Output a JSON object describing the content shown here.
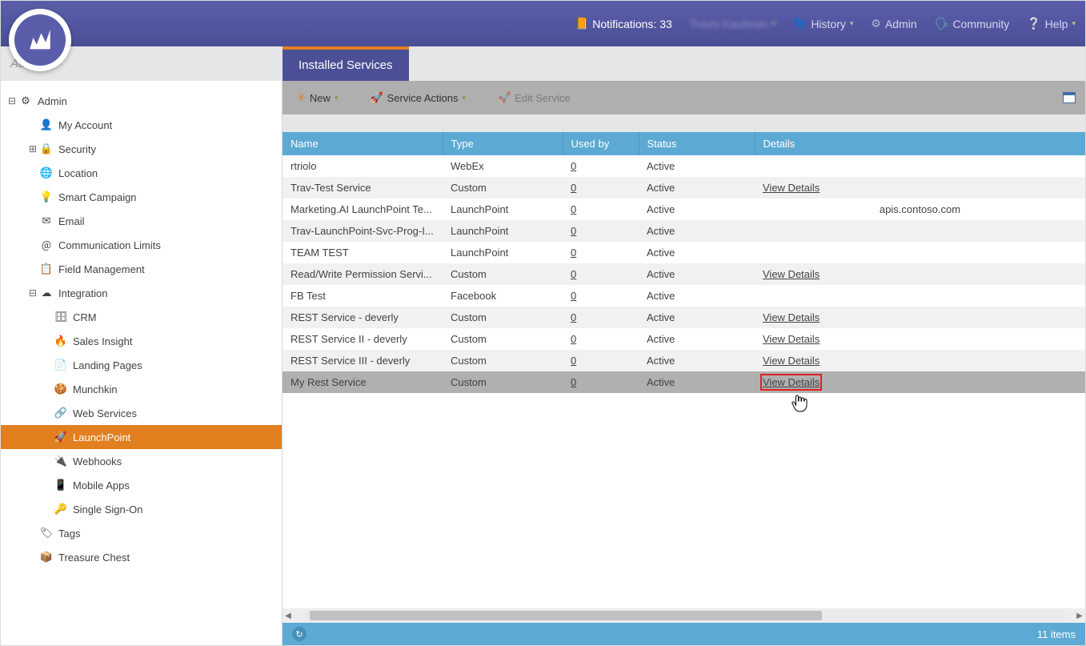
{
  "colors": {
    "purple": "#5a5eaa",
    "orange": "#e27f1f",
    "blue": "#5caad3"
  },
  "topnav": {
    "notifications": {
      "label": "Notifications:",
      "count": "33"
    },
    "user": "Travis Kaufman",
    "history": "History",
    "admin": "Admin",
    "community": "Community",
    "help": "Help"
  },
  "search": {
    "placeholder": "Admin..."
  },
  "tab": {
    "title": "Installed Services"
  },
  "toolbar": {
    "new": "New",
    "service_actions": "Service Actions",
    "edit_service": "Edit Service"
  },
  "sidebar": [
    {
      "depth": 0,
      "expander": "minus",
      "icon": "gear",
      "label": "Admin",
      "interact": true
    },
    {
      "depth": 1,
      "expander": "",
      "icon": "user",
      "label": "My Account",
      "interact": true
    },
    {
      "depth": 1,
      "expander": "plus",
      "icon": "lock",
      "label": "Security",
      "interact": true
    },
    {
      "depth": 1,
      "expander": "",
      "icon": "globe",
      "label": "Location",
      "interact": true
    },
    {
      "depth": 1,
      "expander": "",
      "icon": "bulb",
      "label": "Smart Campaign",
      "interact": true
    },
    {
      "depth": 1,
      "expander": "",
      "icon": "mail",
      "label": "Email",
      "interact": true
    },
    {
      "depth": 1,
      "expander": "",
      "icon": "at",
      "label": "Communication Limits",
      "interact": true
    },
    {
      "depth": 1,
      "expander": "",
      "icon": "form",
      "label": "Field Management",
      "interact": true
    },
    {
      "depth": 1,
      "expander": "minus",
      "icon": "cloud",
      "label": "Integration",
      "interact": true
    },
    {
      "depth": 2,
      "expander": "",
      "icon": "db",
      "label": "CRM",
      "interact": true
    },
    {
      "depth": 2,
      "expander": "",
      "icon": "fire",
      "label": "Sales Insight",
      "interact": true
    },
    {
      "depth": 2,
      "expander": "",
      "icon": "page",
      "label": "Landing Pages",
      "interact": true
    },
    {
      "depth": 2,
      "expander": "",
      "icon": "munchkin",
      "label": "Munchkin",
      "interact": true
    },
    {
      "depth": 2,
      "expander": "",
      "icon": "web",
      "label": "Web Services",
      "interact": true
    },
    {
      "depth": 2,
      "expander": "",
      "icon": "rocket",
      "label": "LaunchPoint",
      "interact": true,
      "selected": true
    },
    {
      "depth": 2,
      "expander": "",
      "icon": "webhook",
      "label": "Webhooks",
      "interact": true
    },
    {
      "depth": 2,
      "expander": "",
      "icon": "mobile",
      "label": "Mobile Apps",
      "interact": true
    },
    {
      "depth": 2,
      "expander": "",
      "icon": "key",
      "label": "Single Sign-On",
      "interact": true
    },
    {
      "depth": 1,
      "expander": "",
      "icon": "tag",
      "label": "Tags",
      "interact": true
    },
    {
      "depth": 1,
      "expander": "",
      "icon": "chest",
      "label": "Treasure Chest",
      "interact": true
    }
  ],
  "grid": {
    "headers": {
      "name": "Name",
      "type": "Type",
      "used_by": "Used by",
      "status": "Status",
      "details": "Details"
    },
    "rows": [
      {
        "name": "rtriolo",
        "type": "WebEx",
        "used_by": "0",
        "status": "Active",
        "details": ""
      },
      {
        "name": "Trav-Test Service",
        "type": "Custom",
        "used_by": "0",
        "status": "Active",
        "details": "View Details"
      },
      {
        "name": "Marketing.AI LaunchPoint Te...",
        "type": "LaunchPoint",
        "used_by": "0",
        "status": "Active",
        "details": "apis.contoso.com",
        "details_plain": true
      },
      {
        "name": "Trav-LaunchPoint-Svc-Prog-I...",
        "type": "LaunchPoint",
        "used_by": "0",
        "status": "Active",
        "details": ""
      },
      {
        "name": "TEAM TEST",
        "type": "LaunchPoint",
        "used_by": "0",
        "status": "Active",
        "details": ""
      },
      {
        "name": "Read/Write Permission Servi...",
        "type": "Custom",
        "used_by": "0",
        "status": "Active",
        "details": "View Details"
      },
      {
        "name": "FB Test",
        "type": "Facebook",
        "used_by": "0",
        "status": "Active",
        "details": ""
      },
      {
        "name": "REST Service - deverly",
        "type": "Custom",
        "used_by": "0",
        "status": "Active",
        "details": "View Details"
      },
      {
        "name": "REST Service II - deverly",
        "type": "Custom",
        "used_by": "0",
        "status": "Active",
        "details": "View Details"
      },
      {
        "name": "REST Service III - deverly",
        "type": "Custom",
        "used_by": "0",
        "status": "Active",
        "details": "View Details"
      },
      {
        "name": "My Rest Service",
        "type": "Custom",
        "used_by": "0",
        "status": "Active",
        "details": "View Details",
        "selected": true,
        "highlight": true
      }
    ]
  },
  "footer": {
    "count": "11 items"
  }
}
